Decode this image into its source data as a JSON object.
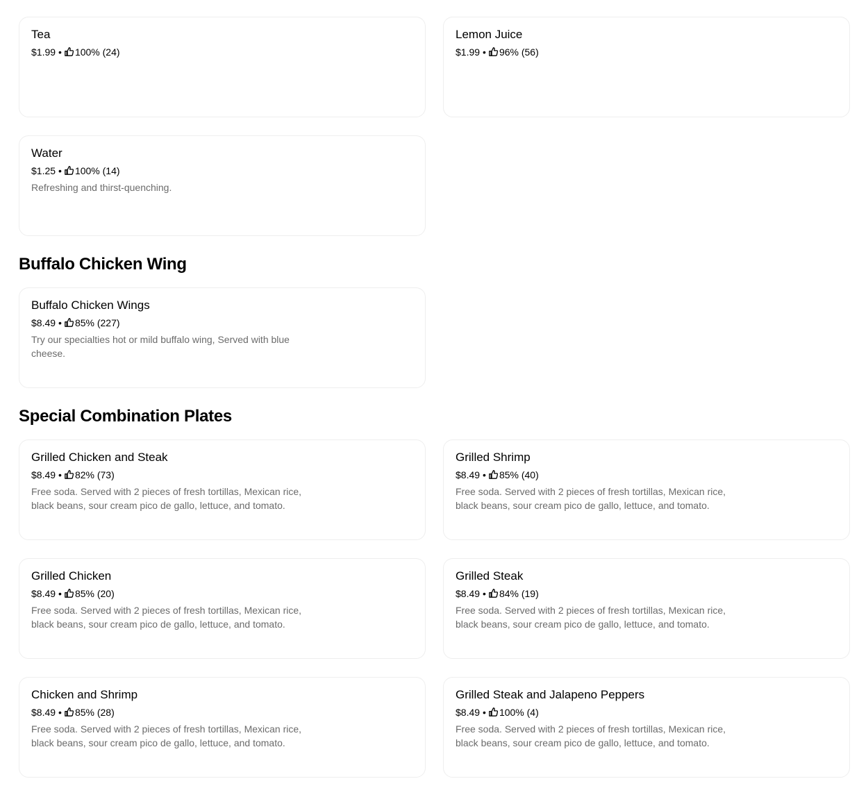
{
  "drinks": {
    "items": [
      {
        "name": "Tea",
        "price": "$1.99",
        "separator": "•",
        "rating": "100% (24)",
        "description": ""
      },
      {
        "name": "Lemon Juice",
        "price": "$1.99",
        "separator": "•",
        "rating": "96% (56)",
        "description": ""
      },
      {
        "name": "Water",
        "price": "$1.25",
        "separator": "•",
        "rating": "100% (14)",
        "description": "Refreshing and thirst-quenching."
      }
    ]
  },
  "buffalo": {
    "title": "Buffalo Chicken Wing",
    "items": [
      {
        "name": "Buffalo Chicken Wings",
        "price": "$8.49",
        "separator": "•",
        "rating": "85% (227)",
        "description": "Try our specialties hot or mild buffalo wing, Served with blue cheese."
      }
    ]
  },
  "combos": {
    "title": "Special Combination Plates",
    "items": [
      {
        "name": "Grilled Chicken and Steak",
        "price": "$8.49",
        "separator": "•",
        "rating": "82% (73)",
        "description": "Free soda. Served with 2 pieces of fresh tortillas, Mexican rice, black beans, sour cream pico de gallo, lettuce, and tomato."
      },
      {
        "name": "Grilled Shrimp",
        "price": "$8.49",
        "separator": "•",
        "rating": "85% (40)",
        "description": "Free soda. Served with 2 pieces of fresh tortillas, Mexican rice, black beans, sour cream pico de gallo, lettuce, and tomato."
      },
      {
        "name": "Grilled Chicken",
        "price": "$8.49",
        "separator": "•",
        "rating": "85% (20)",
        "description": "Free soda. Served with 2 pieces of fresh tortillas, Mexican rice, black beans, sour cream pico de gallo, lettuce, and tomato."
      },
      {
        "name": "Grilled Steak",
        "price": "$8.49",
        "separator": "•",
        "rating": "84% (19)",
        "description": "Free soda. Served with 2 pieces of fresh tortillas, Mexican rice, black beans, sour cream pico de gallo, lettuce, and tomato."
      },
      {
        "name": "Chicken and Shrimp",
        "price": "$8.49",
        "separator": "•",
        "rating": "85% (28)",
        "description": "Free soda. Served with 2 pieces of fresh tortillas, Mexican rice, black beans, sour cream pico de gallo, lettuce, and tomato."
      },
      {
        "name": "Grilled Steak and Jalapeno Peppers",
        "price": "$8.49",
        "separator": "•",
        "rating": "100% (4)",
        "description": "Free soda. Served with 2 pieces of fresh tortillas, Mexican rice, black beans, sour cream pico de gallo, lettuce, and tomato."
      }
    ]
  },
  "icons": {
    "rating": "thumbs-up-icon"
  }
}
